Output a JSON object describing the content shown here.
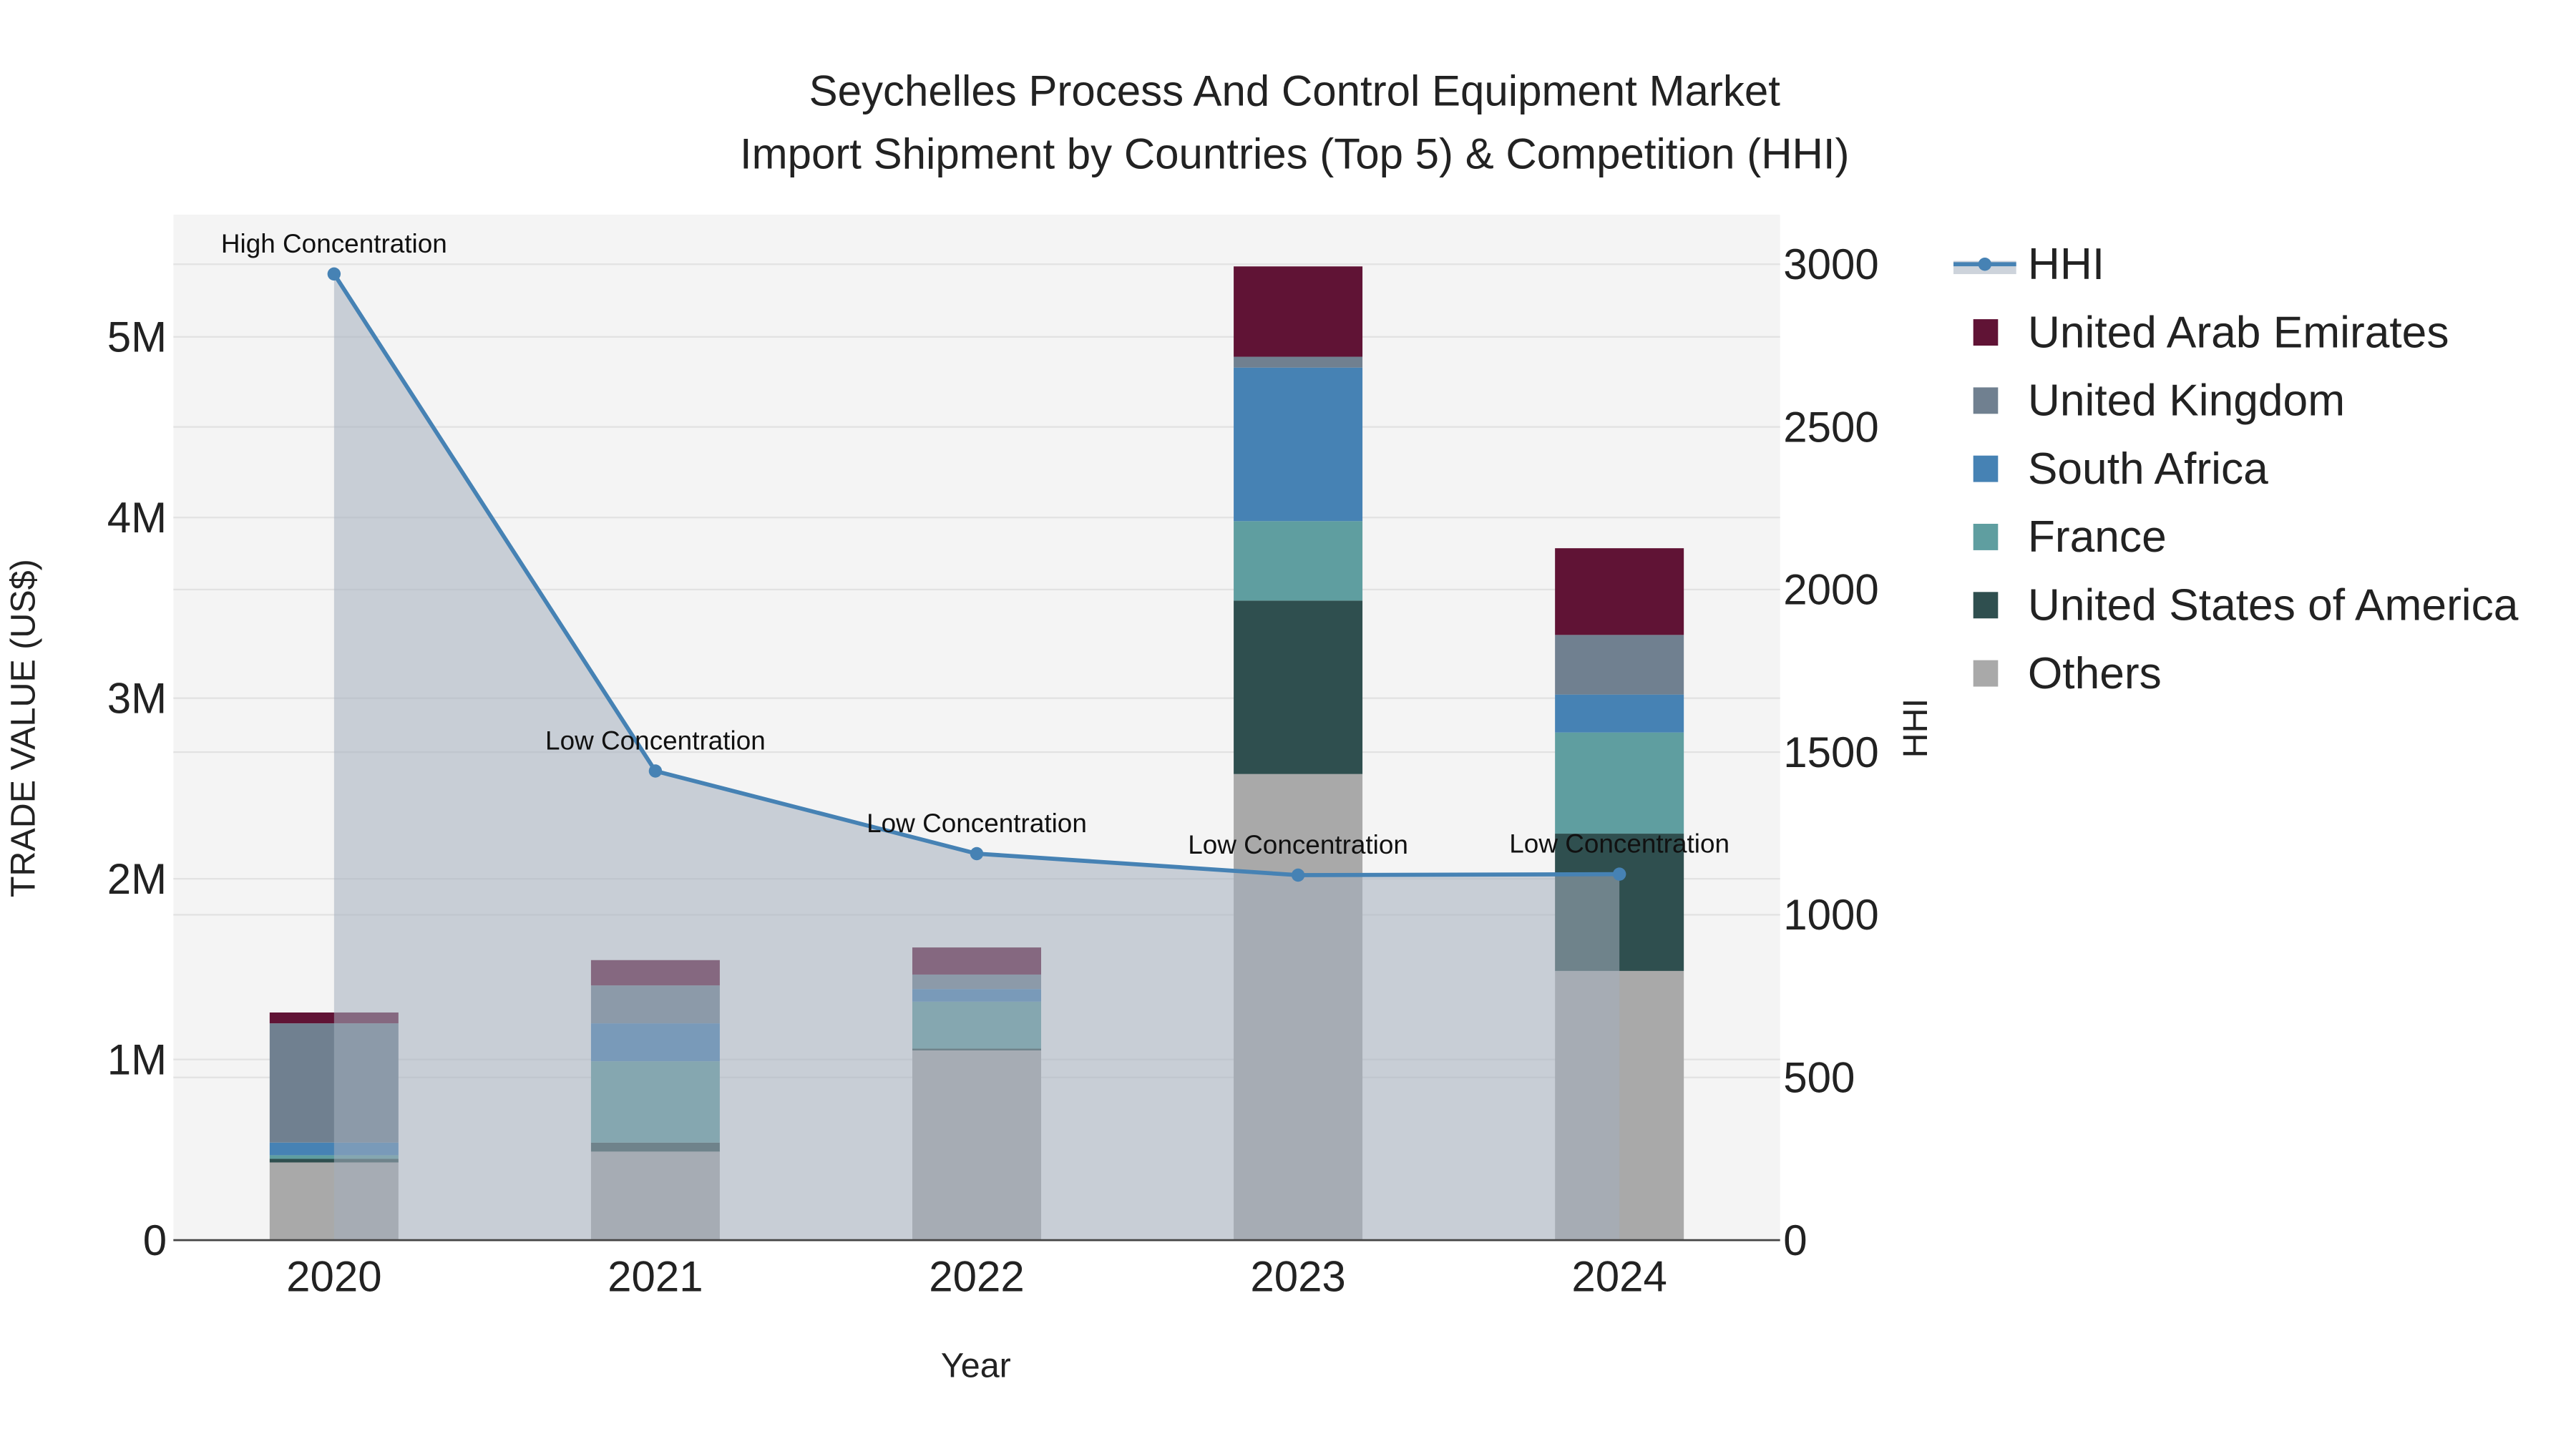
{
  "chart_data": {
    "type": "bar",
    "title": "Seychelles Process And Control Equipment Market",
    "subtitle": "Import Shipment by Countries (Top 5) & Competition (HHI)",
    "xlabel": "Year",
    "ylabel": "TRADE VALUE (US$)",
    "y2label": "HHI",
    "categories": [
      "2020",
      "2021",
      "2022",
      "2023",
      "2024"
    ],
    "ylim": [
      0,
      5500000
    ],
    "y2lim": [
      0,
      3150
    ],
    "yticks": [
      {
        "v": 0,
        "label": "0"
      },
      {
        "v": 1000000,
        "label": "1M"
      },
      {
        "v": 2000000,
        "label": "2M"
      },
      {
        "v": 3000000,
        "label": "3M"
      },
      {
        "v": 4000000,
        "label": "4M"
      },
      {
        "v": 5000000,
        "label": "5M"
      }
    ],
    "y2ticks": [
      {
        "v": 0,
        "label": "0"
      },
      {
        "v": 500,
        "label": "500"
      },
      {
        "v": 1000,
        "label": "1000"
      },
      {
        "v": 1500,
        "label": "1500"
      },
      {
        "v": 2000,
        "label": "2000"
      },
      {
        "v": 2500,
        "label": "2500"
      },
      {
        "v": 3000,
        "label": "3000"
      }
    ],
    "series": [
      {
        "name": "Others",
        "color": "#a9a9a9",
        "values": [
          430000,
          490000,
          1050000,
          2580000,
          1490000
        ]
      },
      {
        "name": "United States of America",
        "color": "#2f4f4f",
        "values": [
          20000,
          50000,
          10000,
          960000,
          760000
        ]
      },
      {
        "name": "France",
        "color": "#5f9ea0",
        "values": [
          20000,
          450000,
          260000,
          440000,
          560000
        ]
      },
      {
        "name": "South Africa",
        "color": "#4682b4",
        "values": [
          70000,
          210000,
          70000,
          850000,
          210000
        ]
      },
      {
        "name": "United Kingdom",
        "color": "#708090",
        "values": [
          660000,
          210000,
          80000,
          60000,
          330000
        ]
      },
      {
        "name": "United Arab Emirates",
        "color": "#601335",
        "values": [
          60000,
          140000,
          150000,
          500000,
          480000
        ]
      }
    ],
    "hhi": {
      "name": "HHI",
      "color": "#4682b4",
      "values": [
        2970,
        1442,
        1188,
        1122,
        1125
      ],
      "labels": [
        "High Concentration",
        "Low Concentration",
        "Low Concentration",
        "Low Concentration",
        "Low Concentration"
      ]
    },
    "legend": [
      "HHI",
      "United Arab Emirates",
      "United Kingdom",
      "South Africa",
      "France",
      "United States of America",
      "Others"
    ],
    "legend_position": "right",
    "grid": true
  }
}
